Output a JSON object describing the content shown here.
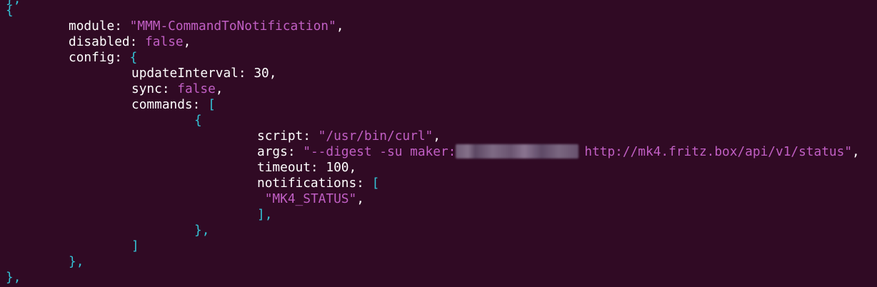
{
  "code": {
    "top_clip": "},",
    "open_brace": "{",
    "module_key": "module:",
    "module_value": "\"MMM-CommandToNotification\"",
    "disabled_key": "disabled:",
    "disabled_value": "false",
    "config_key": "config:",
    "updateInterval_key": "updateInterval:",
    "updateInterval_value": "30",
    "sync_key": "sync:",
    "sync_value": "false",
    "commands_key": "commands:",
    "script_key": "script:",
    "script_value": "\"/usr/bin/curl\"",
    "args_key": "args:",
    "args_value_prefix": "\"--digest -su maker:",
    "args_value_suffix": "http://mk4.fritz.box/api/v1/status\"",
    "timeout_key": "timeout:",
    "timeout_value": "100",
    "notifications_key": "notifications:",
    "notification_value": "\"MK4_STATUS\"",
    "array_close": "],",
    "command_close": "},",
    "commands_close": "]",
    "config_close": "},",
    "module_close": "},"
  },
  "colors": {
    "background": "#300a24",
    "punctuation": "#34c3d6",
    "text": "#ffffff",
    "literal": "#c15fc4"
  }
}
